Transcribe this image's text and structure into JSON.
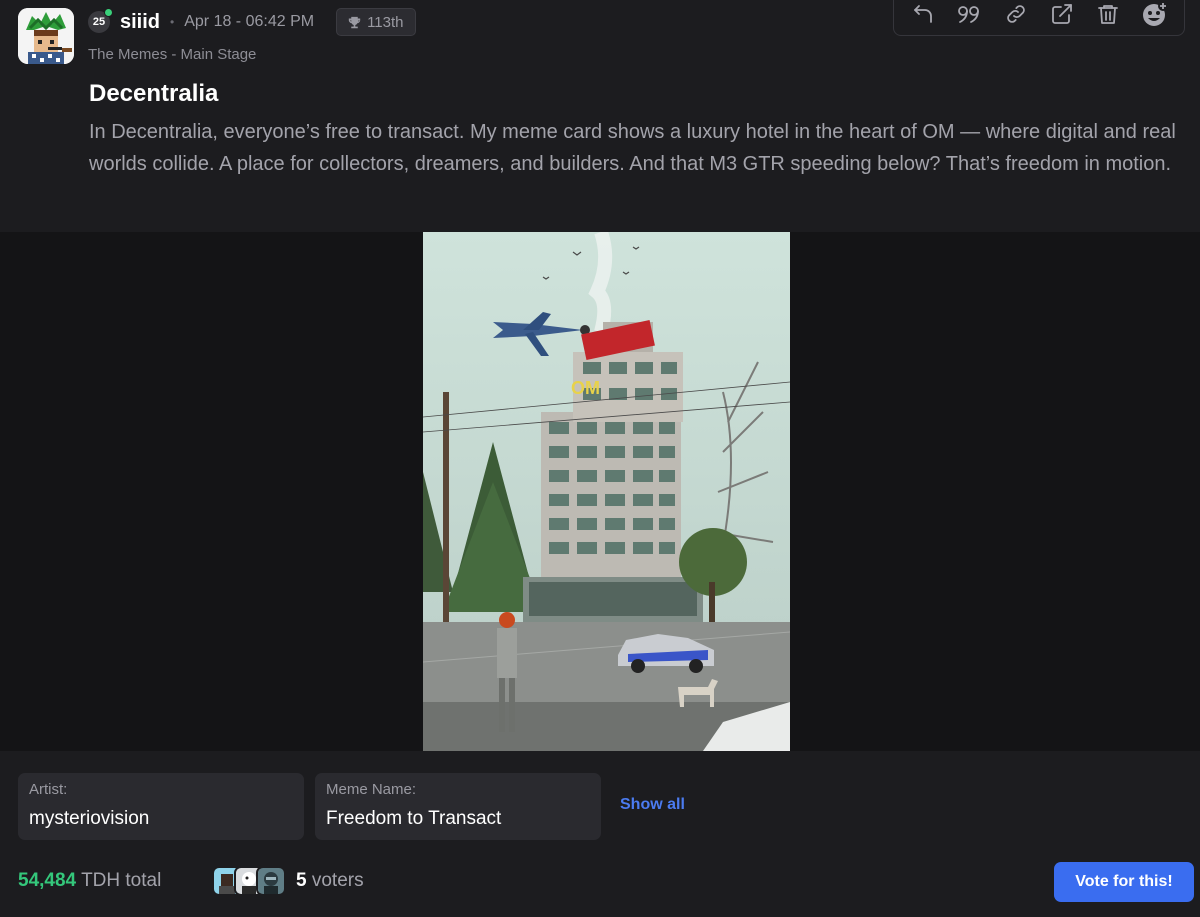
{
  "author": {
    "level": "25",
    "username": "siiid",
    "timestamp": "Apr 18 - 06:42 PM",
    "rank": "113th",
    "online": true
  },
  "wave": {
    "name": "The Memes - Main Stage"
  },
  "actions": [
    {
      "name": "reply",
      "icon": "reply-icon"
    },
    {
      "name": "quote",
      "icon": "quote-icon"
    },
    {
      "name": "copy-link",
      "icon": "link-icon"
    },
    {
      "name": "open-external",
      "icon": "external-link-icon"
    },
    {
      "name": "delete",
      "icon": "trash-icon"
    },
    {
      "name": "add-reaction",
      "icon": "emoji-add-icon"
    }
  ],
  "post": {
    "title": "Decentralia",
    "description": "In Decentralia, everyone’s free to transact. My meme card shows a luxury hotel in the heart of OM — where digital and real worlds collide. A place for collectors, dreamers, and builders. And that M3 GTR speeding below? That’s freedom in motion."
  },
  "artwork": {
    "sign_text": "OM",
    "sky_color": "#c9ddd6",
    "building_color": "#bfbcb4"
  },
  "info": {
    "artist_label": "Artist:",
    "artist_value": "mysteriovision",
    "meme_label": "Meme Name:",
    "meme_value": "Freedom to Transact",
    "show_all": "Show all"
  },
  "footer": {
    "tdh_value": "54,484",
    "tdh_label": "TDH total",
    "voters_count": "5",
    "voters_label": "voters",
    "vote_button": "Vote for this!"
  },
  "colors": {
    "accent": "#3a6df0",
    "tdh_green": "#34c77b",
    "online_green": "#3ad07a",
    "background": "#1c1c1f"
  }
}
